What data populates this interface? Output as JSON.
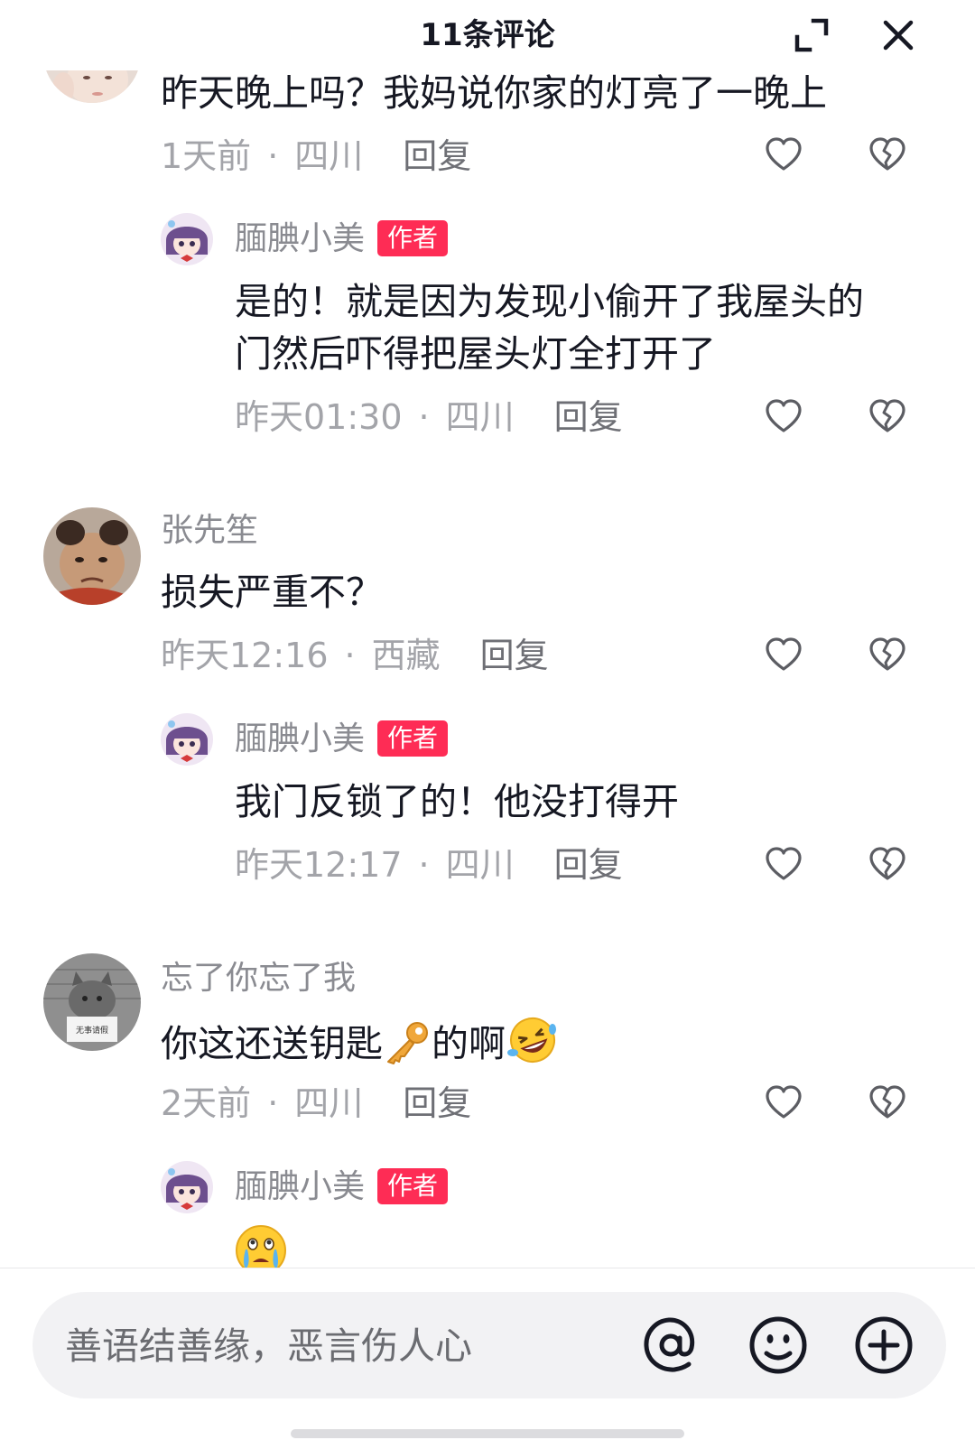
{
  "header": {
    "title": "11条评论"
  },
  "comments": [
    {
      "text": "昨天晚上吗？我妈说你家的灯亮了一晚上",
      "time": "1天前",
      "location": "四川",
      "reply_label": "回复",
      "reply": {
        "username": "腼腆小美",
        "badge": "作者",
        "text_line1": "是的！就是因为发现小偷开了我屋头的",
        "text_line2": "门然后吓得把屋头灯全打开了",
        "time": "昨天01:30",
        "location": "四川",
        "reply_label": "回复"
      }
    },
    {
      "username": "张先笙",
      "text": "损失严重不？",
      "time": "昨天12:16",
      "location": "西藏",
      "reply_label": "回复",
      "reply": {
        "username": "腼腆小美",
        "badge": "作者",
        "text": "我门反锁了的！他没打得开",
        "time": "昨天12:17",
        "location": "四川",
        "reply_label": "回复"
      }
    },
    {
      "username": "忘了你忘了我",
      "text_before": "你这还送钥匙",
      "text_after": "的啊",
      "avatar_sign_text": "无事请假",
      "time": "2天前",
      "location": "四川",
      "reply_label": "回复",
      "reply": {
        "username": "腼腆小美",
        "badge": "作者"
      }
    }
  ],
  "separator": "·",
  "input": {
    "placeholder": "善语结善缘，恶言伤人心"
  },
  "icons": {
    "expand": "expand-icon",
    "close": "close-icon",
    "like": "heart-outline-icon",
    "dislike": "broken-heart-icon",
    "mention": "at-sign-icon",
    "emoji": "smiley-icon",
    "add": "plus-circle-icon",
    "key_emoji": "key-emoji",
    "rofl_emoji": "rolling-laughing-emoji",
    "crying_emoji": "crying-face-emoji"
  },
  "colors": {
    "badge": "#fe2c55",
    "text_primary": "#161823",
    "text_secondary": "#a3a4a9",
    "icon": "#5c5d63"
  }
}
